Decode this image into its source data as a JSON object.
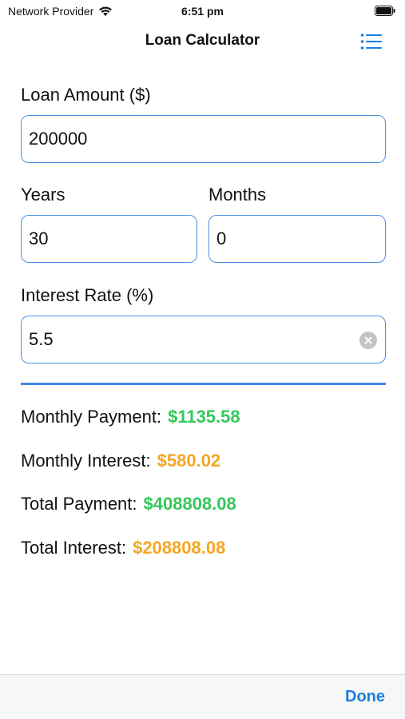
{
  "status_bar": {
    "carrier": "Network Provider",
    "time": "6:51 pm",
    "wifi_icon": "wifi-icon",
    "battery_icon": "battery-icon"
  },
  "nav": {
    "title": "Loan Calculator",
    "menu_icon": "list-icon"
  },
  "form": {
    "loan_amount_label": "Loan Amount ($)",
    "loan_amount_value": "200000",
    "years_label": "Years",
    "years_value": "30",
    "months_label": "Months",
    "months_value": "0",
    "interest_rate_label": "Interest Rate (%)",
    "interest_rate_value": "5.5",
    "clear_icon": "clear-icon"
  },
  "results": {
    "monthly_payment_label": "Monthly Payment:",
    "monthly_payment_value": "$1135.58",
    "monthly_interest_label": "Monthly Interest:",
    "monthly_interest_value": "$580.02",
    "total_payment_label": "Total Payment:",
    "total_payment_value": "$408808.08",
    "total_interest_label": "Total Interest:",
    "total_interest_value": "$208808.08"
  },
  "toolbar": {
    "done_label": "Done"
  },
  "colors": {
    "accent": "#1a7fe0",
    "field_border": "#4a90e2",
    "positive": "#34c759",
    "interest": "#f5a623"
  }
}
